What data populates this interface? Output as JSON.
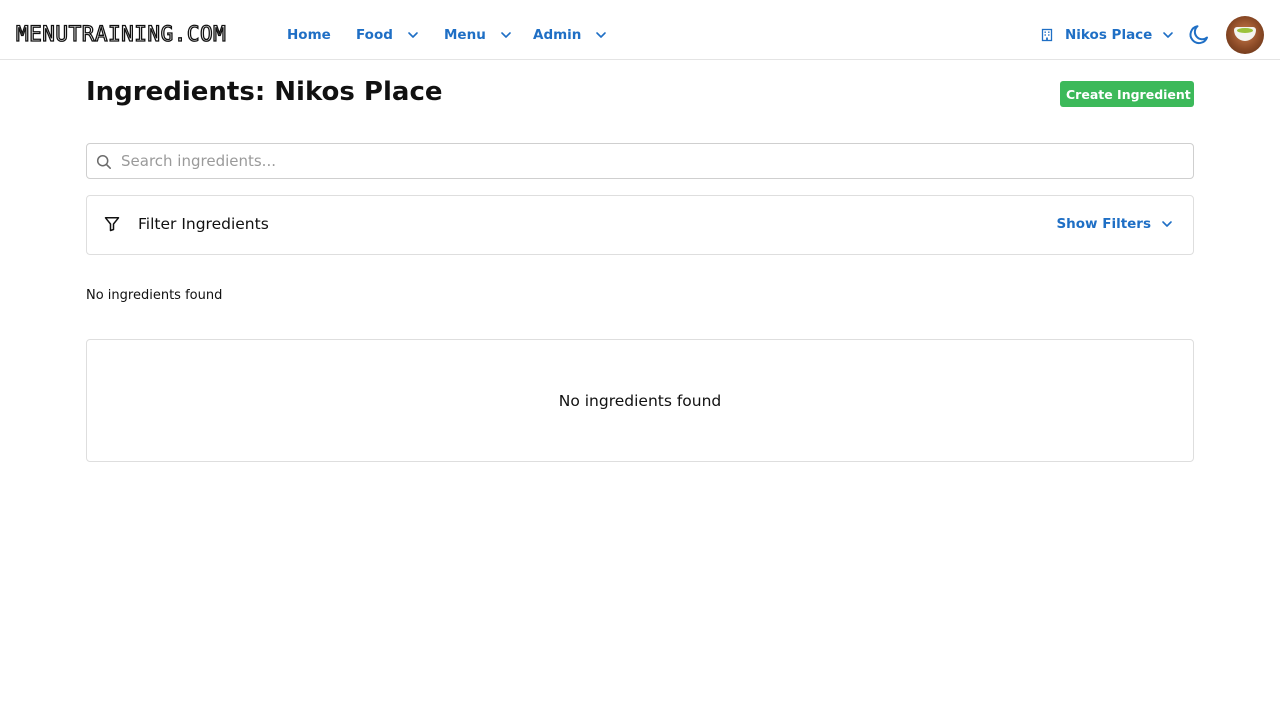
{
  "header": {
    "logo": "MENUTRAINING.COM",
    "nav": [
      {
        "label": "Home",
        "has_dropdown": false
      },
      {
        "label": "Food",
        "has_dropdown": true
      },
      {
        "label": "Menu",
        "has_dropdown": true
      },
      {
        "label": "Admin",
        "has_dropdown": true
      }
    ],
    "org_selector": {
      "label": "Nikos Place",
      "icon": "building-icon"
    },
    "theme_toggle_icon": "moon-icon",
    "avatar_icon": "user-avatar"
  },
  "page": {
    "title": "Ingredients: Nikos Place",
    "create_button": "Create Ingredient",
    "search": {
      "placeholder": "Search ingredients...",
      "value": "",
      "icon": "search-icon"
    },
    "filters": {
      "title": "Filter Ingredients",
      "toggle_label": "Show Filters",
      "icon": "filter-icon"
    },
    "result_text": "No ingredients found",
    "empty_state": "No ingredients found"
  },
  "colors": {
    "link": "#1f6fc5",
    "create_button": "#3cb95a",
    "border": "#dedede"
  }
}
